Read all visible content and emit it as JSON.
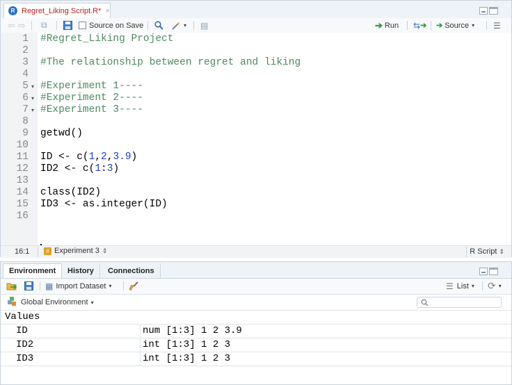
{
  "editor": {
    "tab": {
      "filename": "Regret_Liking Script.R*",
      "close": "×",
      "r_badge": "R"
    },
    "toolbar": {
      "source_on_save": "Source on Save",
      "run": "Run",
      "source": "Source"
    },
    "lines": [
      {
        "n": "1",
        "fold": "",
        "segments": [
          {
            "t": "#Regret_Liking Project",
            "c": "cmt"
          }
        ]
      },
      {
        "n": "2",
        "fold": "",
        "segments": []
      },
      {
        "n": "3",
        "fold": "",
        "segments": [
          {
            "t": "#The relationship between regret and liking",
            "c": "cmt"
          }
        ]
      },
      {
        "n": "4",
        "fold": "",
        "segments": []
      },
      {
        "n": "5",
        "fold": "▾",
        "segments": [
          {
            "t": "#Experiment 1----",
            "c": "cmt"
          }
        ]
      },
      {
        "n": "6",
        "fold": "▾",
        "segments": [
          {
            "t": "#Experiment 2----",
            "c": "cmt"
          }
        ]
      },
      {
        "n": "7",
        "fold": "▾",
        "segments": [
          {
            "t": "#Experiment 3----",
            "c": "cmt"
          }
        ]
      },
      {
        "n": "8",
        "fold": "",
        "segments": []
      },
      {
        "n": "9",
        "fold": "",
        "segments": [
          {
            "t": "getwd()",
            "c": ""
          }
        ]
      },
      {
        "n": "10",
        "fold": "",
        "segments": []
      },
      {
        "n": "11",
        "fold": "",
        "segments": [
          {
            "t": "ID <- c(",
            "c": ""
          },
          {
            "t": "1",
            "c": "num"
          },
          {
            "t": ",",
            "c": ""
          },
          {
            "t": "2",
            "c": "num"
          },
          {
            "t": ",",
            "c": ""
          },
          {
            "t": "3.9",
            "c": "num"
          },
          {
            "t": ")",
            "c": ""
          }
        ]
      },
      {
        "n": "12",
        "fold": "",
        "segments": [
          {
            "t": "ID2 <- c(",
            "c": ""
          },
          {
            "t": "1",
            "c": "num"
          },
          {
            "t": ":",
            "c": ""
          },
          {
            "t": "3",
            "c": "num"
          },
          {
            "t": ")",
            "c": ""
          }
        ]
      },
      {
        "n": "13",
        "fold": "",
        "segments": []
      },
      {
        "n": "14",
        "fold": "",
        "segments": [
          {
            "t": "class(ID2)",
            "c": ""
          }
        ]
      },
      {
        "n": "15",
        "fold": "",
        "segments": [
          {
            "t": "ID3 <- as.integer(ID)",
            "c": ""
          }
        ]
      },
      {
        "n": "16",
        "fold": "",
        "segments": []
      }
    ],
    "status": {
      "position": "16:1",
      "section": "Experiment 3",
      "file_type": "R Script"
    }
  },
  "env": {
    "tabs": [
      {
        "label": "Environment",
        "active": true
      },
      {
        "label": "History",
        "active": false
      },
      {
        "label": "Connections",
        "active": false
      }
    ],
    "toolbar": {
      "import_dataset": "Import Dataset",
      "view_mode": "List"
    },
    "scope": "Global Environment",
    "values_header": "Values",
    "values": [
      {
        "name": "ID",
        "value": "num [1:3] 1 2 3.9"
      },
      {
        "name": "ID2",
        "value": "int [1:3] 1 2 3"
      },
      {
        "name": "ID3",
        "value": "int [1:3] 1 2 3"
      }
    ]
  },
  "colors": {
    "comment": "#4d8a5e",
    "number": "#1f3fc4",
    "modified_tab": "#b22222"
  }
}
